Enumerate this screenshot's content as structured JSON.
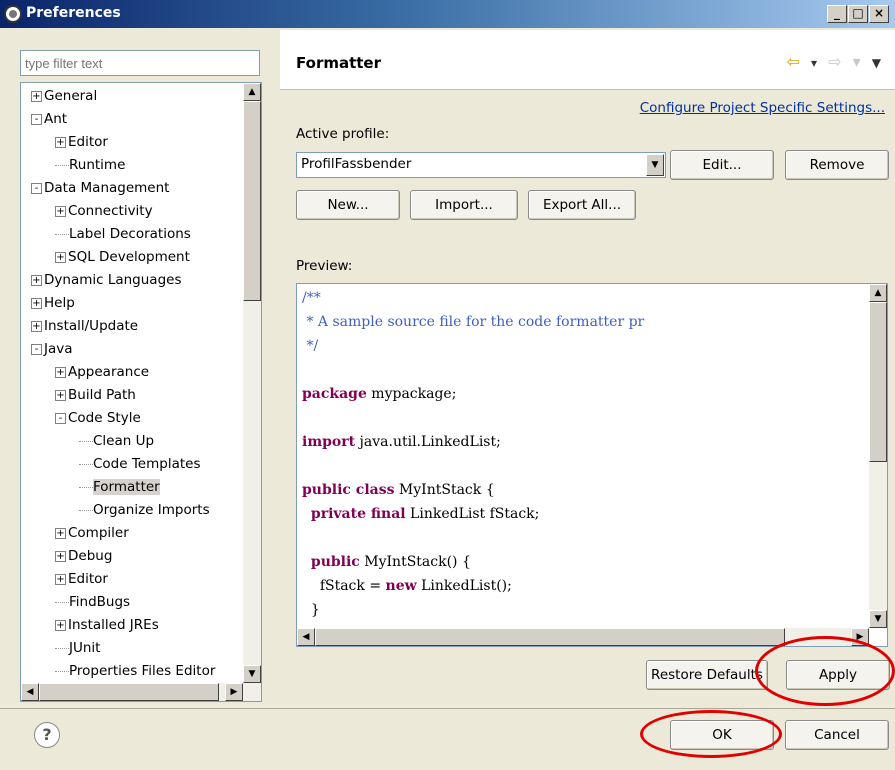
{
  "window": {
    "title": "Preferences",
    "controls": [
      "_",
      "□",
      "×"
    ]
  },
  "filter": {
    "placeholder": "type filter text"
  },
  "tree": {
    "items": [
      {
        "label": "General",
        "expander": "+"
      },
      {
        "label": "Ant",
        "expander": "-"
      },
      {
        "label": "Editor",
        "expander": "+"
      },
      {
        "label": "Runtime",
        "expander": ""
      },
      {
        "label": "Data Management",
        "expander": "-"
      },
      {
        "label": "Connectivity",
        "expander": "+"
      },
      {
        "label": "Label Decorations",
        "expander": ""
      },
      {
        "label": "SQL Development",
        "expander": "+"
      },
      {
        "label": "Dynamic Languages",
        "expander": "+"
      },
      {
        "label": "Help",
        "expander": "+"
      },
      {
        "label": "Install/Update",
        "expander": "+"
      },
      {
        "label": "Java",
        "expander": "-"
      },
      {
        "label": "Appearance",
        "expander": "+"
      },
      {
        "label": "Build Path",
        "expander": "+"
      },
      {
        "label": "Code Style",
        "expander": "-"
      },
      {
        "label": "Clean Up",
        "expander": ""
      },
      {
        "label": "Code Templates",
        "expander": ""
      },
      {
        "label": "Formatter",
        "expander": ""
      },
      {
        "label": "Organize Imports",
        "expander": ""
      },
      {
        "label": "Compiler",
        "expander": "+"
      },
      {
        "label": "Debug",
        "expander": "+"
      },
      {
        "label": "Editor",
        "expander": "+"
      },
      {
        "label": "FindBugs",
        "expander": ""
      },
      {
        "label": "Installed JREs",
        "expander": "+"
      },
      {
        "label": "JUnit",
        "expander": ""
      },
      {
        "label": "Properties Files Editor",
        "expander": ""
      }
    ],
    "selected": "Formatter"
  },
  "page": {
    "title": "Formatter",
    "nav_back": "⇦",
    "nav_back_menu": "▾",
    "nav_forward": "⇨",
    "nav_forward_menu": "▾",
    "nav_view_menu": "▼",
    "configure_link": "Configure Project Specific Settings...",
    "active_profile_label": "Active profile:",
    "active_profile_value": "ProfilFassbender",
    "edit_button": "Edit...",
    "remove_button": "Remove",
    "new_button": "New...",
    "import_button": "Import...",
    "export_button": "Export All...",
    "preview_label": "Preview:"
  },
  "preview_code": [
    {
      "text": "/**",
      "kind": "comment"
    },
    {
      "text": " * A sample source file for the code formatter pr",
      "kind": "comment"
    },
    {
      "text": " */",
      "kind": "comment"
    },
    {
      "text": "",
      "kind": "plain"
    },
    {
      "kw": "package",
      "text": " mypackage;"
    },
    {
      "text": "",
      "kind": "plain"
    },
    {
      "kw": "import",
      "text": " java.util.LinkedList;"
    },
    {
      "text": "",
      "kind": "plain"
    },
    {
      "kw": "public class",
      "text": " MyIntStack {"
    },
    {
      "indent": "  ",
      "kw": "private final",
      "text": " LinkedList fStack;"
    },
    {
      "text": "",
      "kind": "plain"
    },
    {
      "indent": "  ",
      "kw": "public",
      "text": " MyIntStack() {"
    },
    {
      "indent": "    ",
      "text_before": "fStack = ",
      "kw": "new",
      "text": " LinkedList();"
    },
    {
      "text": "  }",
      "kind": "plain"
    }
  ],
  "buttons": {
    "restore_defaults": "Restore Defaults",
    "apply": "Apply",
    "ok": "OK",
    "cancel": "Cancel"
  },
  "help": {
    "glyph": "?"
  },
  "colors": {
    "keyword": "#7f0055",
    "comment": "#3f5fbf",
    "annotation_circle": "#e00000",
    "link": "#00309c"
  }
}
